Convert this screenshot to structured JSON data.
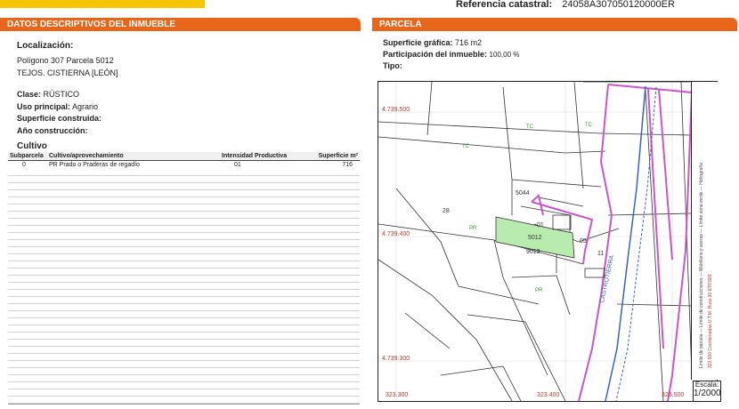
{
  "reference": {
    "label": "Referencia catastral:",
    "value": "24058A307050120000ER"
  },
  "left": {
    "header": "DATOS DESCRIPTIVOS DEL INMUEBLE",
    "location_label": "Localización:",
    "location_lines": [
      "Polígono 307 Parcela 5012",
      "TEJOS. CISTIERNA [LEÓN]"
    ],
    "clase_label": "Clase:",
    "clase_value": "RÚSTICO",
    "uso_label": "Uso principal:",
    "uso_value": "Agrario",
    "superficie_label": "Superficie construida:",
    "anio_label": "Año construcción:",
    "cultivo_title": "Cultivo",
    "columns": [
      "Subparcela",
      "Cultivo/aprovechamiento",
      "Intensidad Productiva",
      "Superficie m²"
    ],
    "rows": [
      [
        "0",
        "PR Prado o Praderas de regadío",
        "01",
        "716"
      ]
    ]
  },
  "right": {
    "header": "PARCELA",
    "superficie_label": "Superficie gráfica:",
    "superficie_value": "716 m2",
    "participacion_label": "Participación del inmueble:",
    "participacion_value": "100,00 %",
    "tipo_label": "Tipo:",
    "map": {
      "coords": {
        "y1": "4.739.500",
        "y2": "4.739.400",
        "y3": "4.739.300",
        "x1": "323.300",
        "x2": "323.400",
        "x3": "323.500"
      },
      "labels": {
        "p5044": "5044",
        "p28": "28",
        "p5012": "5012",
        "p9013": "9013",
        "p05": "05",
        "p11": "11",
        "p01": "01"
      },
      "crops": {
        "tc": "TC",
        "pr": "PR",
        "tc2": "TC",
        "pr2": "PR",
        "tc3": "TC"
      },
      "road_label": "CASTROTIERRA",
      "legend_text": "Límite de parcela — Límite de construcciones — Mobiliario y aceras — Límite zona verde — Hidrografía",
      "legend_note": "323.500 Coordenadas U.T.M. Huso 30 ETRS89"
    },
    "scale_label": "Escala:",
    "scale_value": "1/2000"
  }
}
